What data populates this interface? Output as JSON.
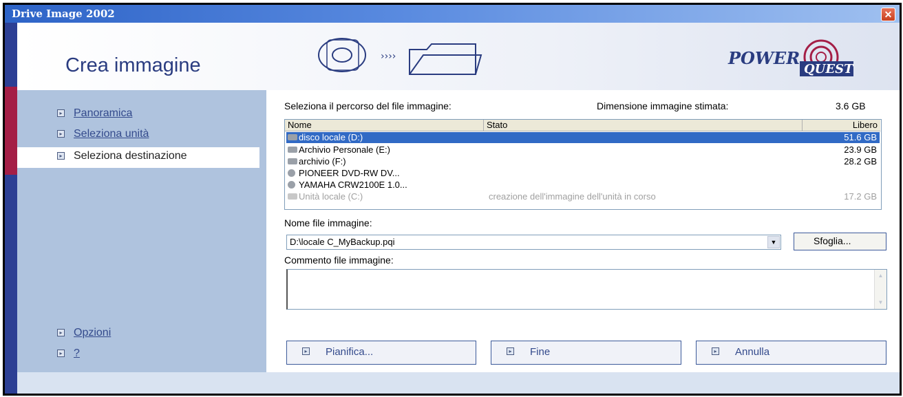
{
  "window": {
    "title": "Drive Image 2002"
  },
  "header": {
    "title": "Crea immagine",
    "logo_text": "POWER",
    "logo_sub": "QUEST"
  },
  "nav": {
    "items": [
      {
        "label": "Panoramica"
      },
      {
        "label": "Seleziona unità"
      },
      {
        "label": "Seleziona destinazione"
      }
    ],
    "bottom": [
      {
        "label": "Opzioni"
      },
      {
        "label": "?"
      }
    ]
  },
  "main": {
    "path_label": "Seleziona il percorso del file immagine:",
    "size_label": "Dimensione immagine stimata:",
    "size_value": "3.6 GB",
    "columns": {
      "name": "Nome",
      "status": "Stato",
      "free": "Libero"
    },
    "drives": [
      {
        "name": "disco locale  (D:)",
        "status": "",
        "free": "51.6 GB"
      },
      {
        "name": "Archivio Personale (E:)",
        "status": "",
        "free": "23.9 GB"
      },
      {
        "name": "archivio  (F:)",
        "status": "",
        "free": "28.2 GB"
      },
      {
        "name": "PIONEER DVD-RW  DV...",
        "status": "",
        "free": ""
      },
      {
        "name": "YAMAHA CRW2100E 1.0...",
        "status": "",
        "free": ""
      },
      {
        "name": "Unità locale (C:)",
        "status": "creazione dell'immagine dell'unità in corso",
        "free": "17.2 GB"
      }
    ],
    "filename_label": "Nome file immagine:",
    "filename_value": "D:\\locale C_MyBackup.pqi",
    "browse_label": "Sfoglia...",
    "comment_label": "Commento file immagine:",
    "comment_value": ""
  },
  "buttons": {
    "schedule": "Pianifica...",
    "finish": "Fine",
    "cancel": "Annulla"
  },
  "icons": {
    "nav_bullet": "arrow-box-icon",
    "drive": "hard-drive-icon",
    "cd": "cd-drive-icon"
  }
}
